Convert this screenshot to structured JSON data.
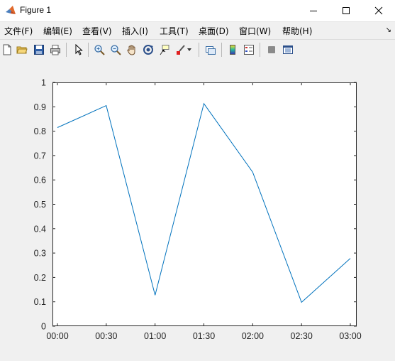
{
  "window": {
    "title": "Figure 1",
    "controls": [
      "minimize",
      "maximize",
      "close"
    ]
  },
  "menubar": {
    "items": [
      {
        "label": "文件(F)"
      },
      {
        "label": "编辑(E)"
      },
      {
        "label": "查看(V)"
      },
      {
        "label": "插入(I)"
      },
      {
        "label": "工具(T)"
      },
      {
        "label": "桌面(D)"
      },
      {
        "label": "窗口(W)"
      },
      {
        "label": "帮助(H)"
      }
    ],
    "overflow_glyph": "↘"
  },
  "toolbar": {
    "icons": [
      "new-figure-icon",
      "open-file-icon",
      "save-icon",
      "print-icon",
      "edit-plot-arrow-icon",
      "zoom-in-icon",
      "zoom-out-icon",
      "pan-hand-icon",
      "rotate-3d-icon",
      "data-cursor-icon",
      "brush-icon",
      "brush-dropdown-icon",
      "link-plot-icon",
      "colorbar-icon",
      "legend-icon",
      "hide-plot-tools-icon",
      "show-plot-tools-icon"
    ]
  },
  "chart_data": {
    "type": "line",
    "x": [
      "00:00",
      "00:30",
      "01:00",
      "01:30",
      "02:00",
      "02:30",
      "03:00"
    ],
    "series": [
      {
        "values": [
          0.815,
          0.905,
          0.127,
          0.913,
          0.632,
          0.098,
          0.278
        ],
        "color": "#0072bd"
      }
    ],
    "xticks": [
      "00:00",
      "00:30",
      "01:00",
      "01:30",
      "02:00",
      "02:30",
      "03:00"
    ],
    "yticks": [
      "0",
      "0.1",
      "0.2",
      "0.3",
      "0.4",
      "0.5",
      "0.6",
      "0.7",
      "0.8",
      "0.9",
      "1"
    ],
    "ylim": [
      0,
      1
    ],
    "grid": false,
    "title": "",
    "xlabel": "",
    "ylabel": ""
  }
}
